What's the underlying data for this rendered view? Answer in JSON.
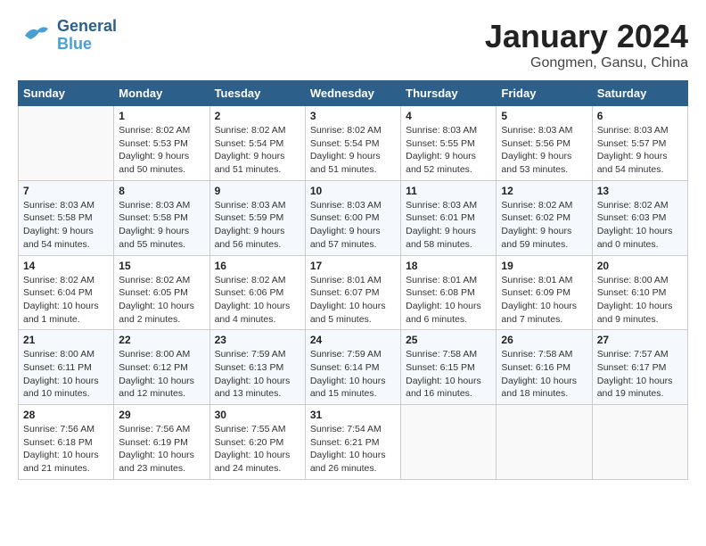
{
  "header": {
    "logo_general": "General",
    "logo_blue": "Blue",
    "title": "January 2024",
    "subtitle": "Gongmen, Gansu, China"
  },
  "weekdays": [
    "Sunday",
    "Monday",
    "Tuesday",
    "Wednesday",
    "Thursday",
    "Friday",
    "Saturday"
  ],
  "weeks": [
    [
      {
        "num": "",
        "info": ""
      },
      {
        "num": "1",
        "info": "Sunrise: 8:02 AM\nSunset: 5:53 PM\nDaylight: 9 hours\nand 50 minutes."
      },
      {
        "num": "2",
        "info": "Sunrise: 8:02 AM\nSunset: 5:54 PM\nDaylight: 9 hours\nand 51 minutes."
      },
      {
        "num": "3",
        "info": "Sunrise: 8:02 AM\nSunset: 5:54 PM\nDaylight: 9 hours\nand 51 minutes."
      },
      {
        "num": "4",
        "info": "Sunrise: 8:03 AM\nSunset: 5:55 PM\nDaylight: 9 hours\nand 52 minutes."
      },
      {
        "num": "5",
        "info": "Sunrise: 8:03 AM\nSunset: 5:56 PM\nDaylight: 9 hours\nand 53 minutes."
      },
      {
        "num": "6",
        "info": "Sunrise: 8:03 AM\nSunset: 5:57 PM\nDaylight: 9 hours\nand 54 minutes."
      }
    ],
    [
      {
        "num": "7",
        "info": "Sunrise: 8:03 AM\nSunset: 5:58 PM\nDaylight: 9 hours\nand 54 minutes."
      },
      {
        "num": "8",
        "info": "Sunrise: 8:03 AM\nSunset: 5:58 PM\nDaylight: 9 hours\nand 55 minutes."
      },
      {
        "num": "9",
        "info": "Sunrise: 8:03 AM\nSunset: 5:59 PM\nDaylight: 9 hours\nand 56 minutes."
      },
      {
        "num": "10",
        "info": "Sunrise: 8:03 AM\nSunset: 6:00 PM\nDaylight: 9 hours\nand 57 minutes."
      },
      {
        "num": "11",
        "info": "Sunrise: 8:03 AM\nSunset: 6:01 PM\nDaylight: 9 hours\nand 58 minutes."
      },
      {
        "num": "12",
        "info": "Sunrise: 8:02 AM\nSunset: 6:02 PM\nDaylight: 9 hours\nand 59 minutes."
      },
      {
        "num": "13",
        "info": "Sunrise: 8:02 AM\nSunset: 6:03 PM\nDaylight: 10 hours\nand 0 minutes."
      }
    ],
    [
      {
        "num": "14",
        "info": "Sunrise: 8:02 AM\nSunset: 6:04 PM\nDaylight: 10 hours\nand 1 minute."
      },
      {
        "num": "15",
        "info": "Sunrise: 8:02 AM\nSunset: 6:05 PM\nDaylight: 10 hours\nand 2 minutes."
      },
      {
        "num": "16",
        "info": "Sunrise: 8:02 AM\nSunset: 6:06 PM\nDaylight: 10 hours\nand 4 minutes."
      },
      {
        "num": "17",
        "info": "Sunrise: 8:01 AM\nSunset: 6:07 PM\nDaylight: 10 hours\nand 5 minutes."
      },
      {
        "num": "18",
        "info": "Sunrise: 8:01 AM\nSunset: 6:08 PM\nDaylight: 10 hours\nand 6 minutes."
      },
      {
        "num": "19",
        "info": "Sunrise: 8:01 AM\nSunset: 6:09 PM\nDaylight: 10 hours\nand 7 minutes."
      },
      {
        "num": "20",
        "info": "Sunrise: 8:00 AM\nSunset: 6:10 PM\nDaylight: 10 hours\nand 9 minutes."
      }
    ],
    [
      {
        "num": "21",
        "info": "Sunrise: 8:00 AM\nSunset: 6:11 PM\nDaylight: 10 hours\nand 10 minutes."
      },
      {
        "num": "22",
        "info": "Sunrise: 8:00 AM\nSunset: 6:12 PM\nDaylight: 10 hours\nand 12 minutes."
      },
      {
        "num": "23",
        "info": "Sunrise: 7:59 AM\nSunset: 6:13 PM\nDaylight: 10 hours\nand 13 minutes."
      },
      {
        "num": "24",
        "info": "Sunrise: 7:59 AM\nSunset: 6:14 PM\nDaylight: 10 hours\nand 15 minutes."
      },
      {
        "num": "25",
        "info": "Sunrise: 7:58 AM\nSunset: 6:15 PM\nDaylight: 10 hours\nand 16 minutes."
      },
      {
        "num": "26",
        "info": "Sunrise: 7:58 AM\nSunset: 6:16 PM\nDaylight: 10 hours\nand 18 minutes."
      },
      {
        "num": "27",
        "info": "Sunrise: 7:57 AM\nSunset: 6:17 PM\nDaylight: 10 hours\nand 19 minutes."
      }
    ],
    [
      {
        "num": "28",
        "info": "Sunrise: 7:56 AM\nSunset: 6:18 PM\nDaylight: 10 hours\nand 21 minutes."
      },
      {
        "num": "29",
        "info": "Sunrise: 7:56 AM\nSunset: 6:19 PM\nDaylight: 10 hours\nand 23 minutes."
      },
      {
        "num": "30",
        "info": "Sunrise: 7:55 AM\nSunset: 6:20 PM\nDaylight: 10 hours\nand 24 minutes."
      },
      {
        "num": "31",
        "info": "Sunrise: 7:54 AM\nSunset: 6:21 PM\nDaylight: 10 hours\nand 26 minutes."
      },
      {
        "num": "",
        "info": ""
      },
      {
        "num": "",
        "info": ""
      },
      {
        "num": "",
        "info": ""
      }
    ]
  ]
}
